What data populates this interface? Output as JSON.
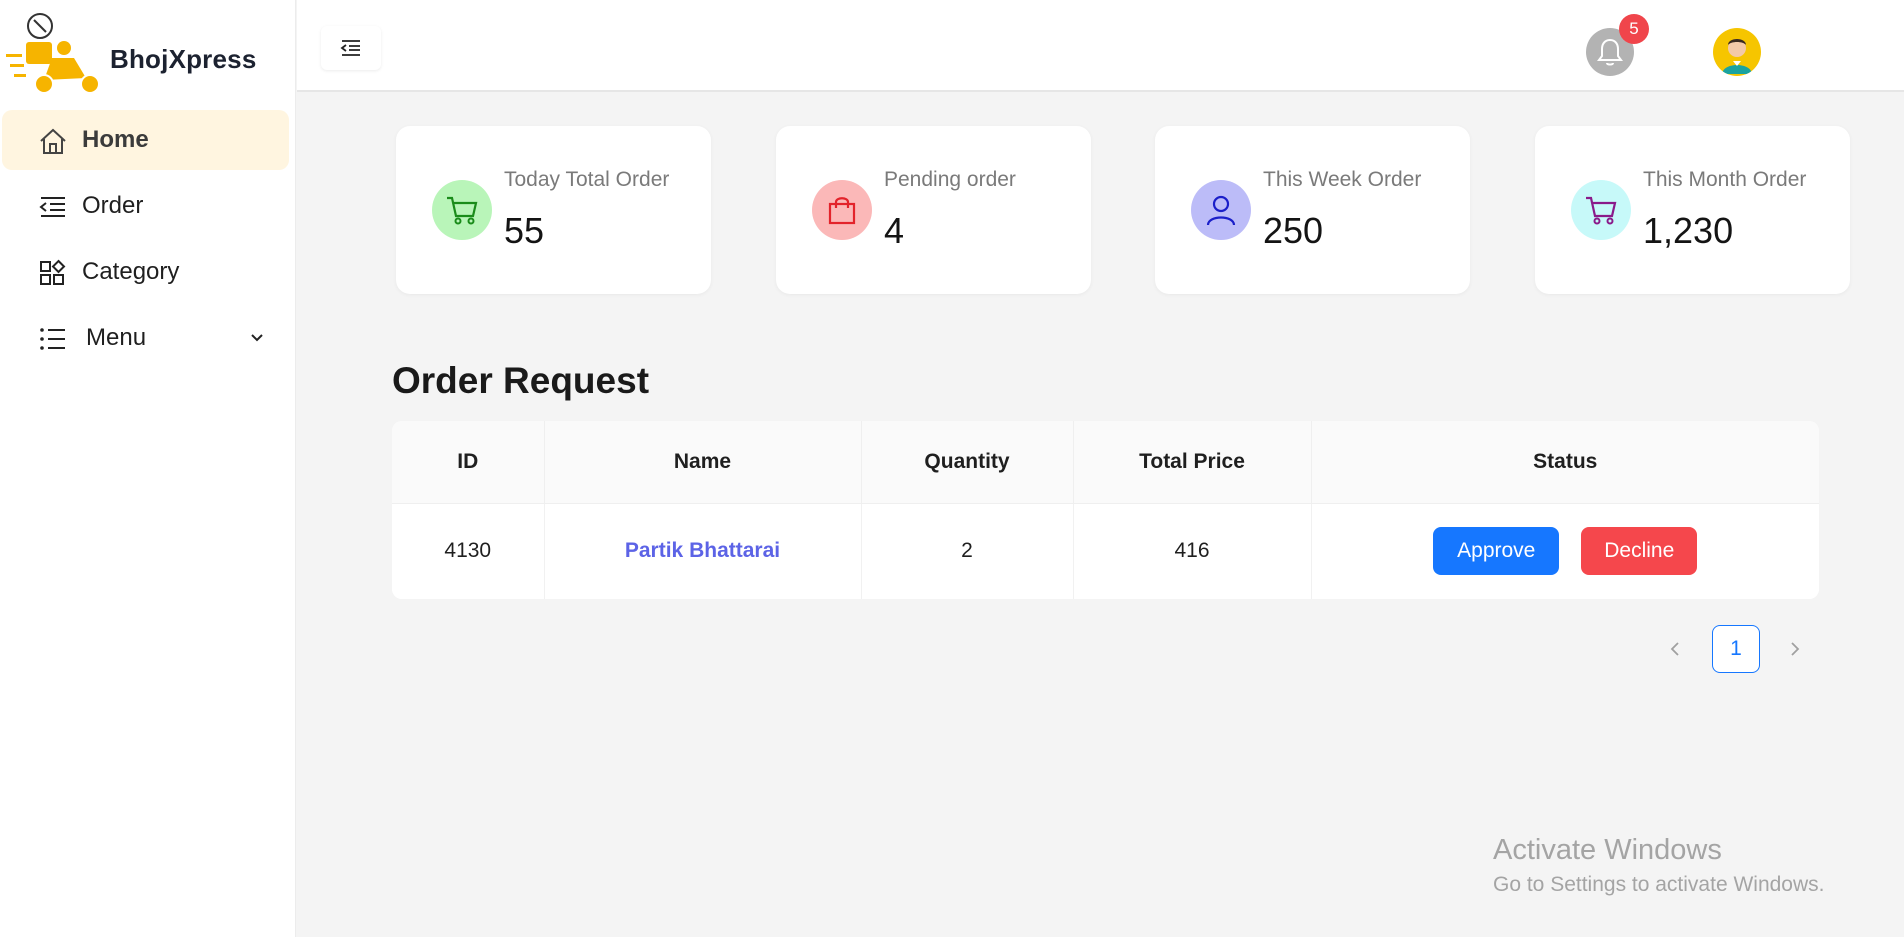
{
  "brand": {
    "name": "BhojXpress"
  },
  "sidebar": {
    "items": [
      {
        "label": "Home",
        "icon": "home-icon",
        "active": true
      },
      {
        "label": "Order",
        "icon": "list-indent-icon"
      },
      {
        "label": "Category",
        "icon": "category-grid-icon"
      },
      {
        "label": "Menu",
        "icon": "menu-list-icon",
        "has_submenu": true
      }
    ]
  },
  "header": {
    "notifications": {
      "count": "5",
      "icon": "bell-icon"
    },
    "avatar": {
      "icon": "user-avatar-icon"
    }
  },
  "stats": [
    {
      "title": "Today Total Order",
      "value": "55",
      "icon": "cart-icon",
      "icon_color": "#1a8c1a",
      "bg_color": "#b9f5b9"
    },
    {
      "title": "Pending order",
      "value": "4",
      "icon": "shopping-bag-icon",
      "icon_color": "#e3232b",
      "bg_color": "#fbb8b8"
    },
    {
      "title": "This Week Order",
      "value": "250",
      "icon": "user-icon",
      "icon_color": "#1b1fc9",
      "bg_color": "#bcbcf8"
    },
    {
      "title": "This Month Order",
      "value": "1,230",
      "icon": "cart-icon",
      "icon_color": "#8a1a8a",
      "bg_color": "#c7f9f9"
    }
  ],
  "orders": {
    "title": "Order Request",
    "columns": [
      "ID",
      "Name",
      "Quantity",
      "Total Price",
      "Status"
    ],
    "rows": [
      {
        "id": "4130",
        "name": "Partik Bhattarai",
        "quantity": "2",
        "total_price": "416",
        "approve_label": "Approve",
        "decline_label": "Decline"
      }
    ]
  },
  "pagination": {
    "current": "1",
    "prev_icon": "chevron-left-icon",
    "next_icon": "chevron-right-icon"
  },
  "watermark": {
    "title": "Activate Windows",
    "subtitle": "Go to Settings to activate Windows."
  },
  "colors": {
    "accent": "#1677ff",
    "danger": "#f5474c",
    "active_nav_bg": "#fff5e0",
    "brand_yellow": "#f6b400"
  }
}
